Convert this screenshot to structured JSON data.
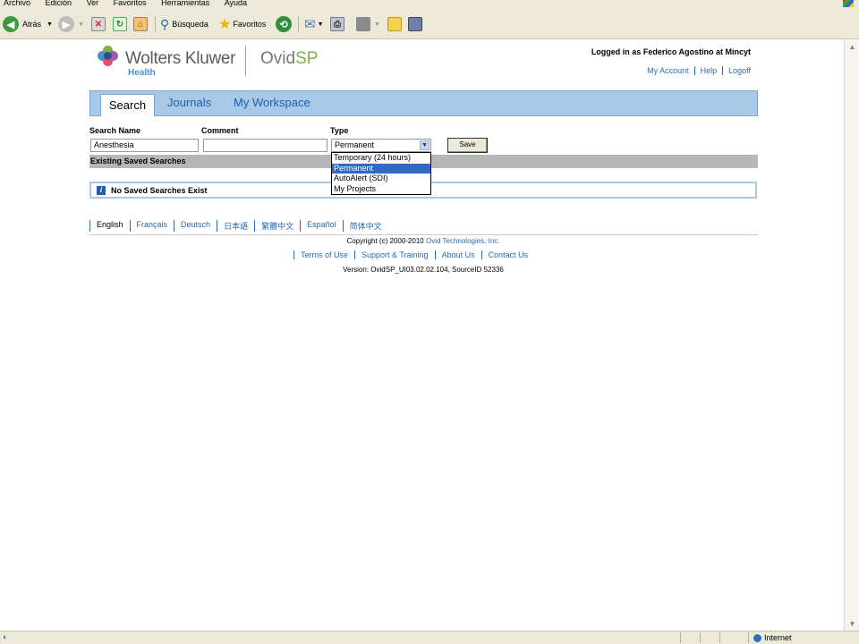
{
  "ie": {
    "menu": [
      "Archivo",
      "Edición",
      "Ver",
      "Favoritos",
      "Herramientas",
      "Ayuda"
    ],
    "back_label": "Atrás",
    "search_label": "Búsqueda",
    "favorites_label": "Favoritos",
    "status_zone": "Internet"
  },
  "brand": {
    "name": "Wolters Kluwer",
    "sub": "Health",
    "product_a": "Ovid",
    "product_b": "SP"
  },
  "user": {
    "logged_in": "Logged in as Federico Agostino at Mincyt",
    "links": [
      "My Account",
      "Help",
      "Logoff"
    ]
  },
  "tabs": [
    "Search",
    "Journals",
    "My Workspace"
  ],
  "form": {
    "search_name_label": "Search Name",
    "comment_label": "Comment",
    "type_label": "Type",
    "search_name_value": "Anesthesia",
    "comment_value": "",
    "type_value": "Permanent",
    "save_label": "Save",
    "type_options": [
      "Temporary (24 hours)",
      "Permanent",
      "AutoAlert (SDI)",
      "My Projects"
    ],
    "selected_option": "Permanent"
  },
  "existing_header": "Existing Saved Searches",
  "no_saved": "No Saved Searches Exist",
  "languages": [
    "English",
    "Français",
    "Deutsch",
    "日本語",
    "繁體中文",
    "Español",
    "简体中文"
  ],
  "footer": {
    "copyright": "Copyright (c) 2000-2010",
    "company": "Ovid Technologies, Inc.",
    "links": [
      "Terms of Use",
      "Support & Training",
      "About Us",
      "Contact Us"
    ],
    "version": "Version: OvidSP_UI03.02.02.104, SourceID 52336"
  },
  "colors": {
    "nav_bg": "#a9c8e6",
    "link": "#2a6aad",
    "select_highlight": "#316ac5",
    "brand_green": "#7cb342"
  }
}
